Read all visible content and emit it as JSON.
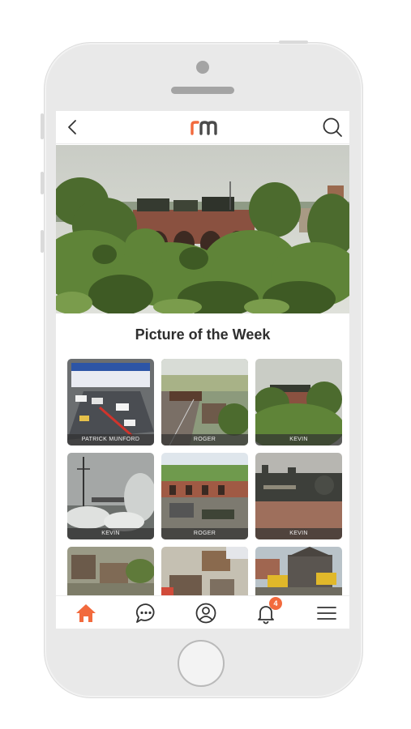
{
  "app": {
    "logo_text": "rm",
    "section_title": "Picture of the Week",
    "accent_color": "#f26a3d"
  },
  "topbar": {
    "back_icon": "chevron-left-icon",
    "search_icon": "search-icon"
  },
  "gallery": [
    {
      "caption": "PATRICK MUNFORD"
    },
    {
      "caption": "ROGER"
    },
    {
      "caption": "KEVIN"
    },
    {
      "caption": "KEVIN"
    },
    {
      "caption": "ROGER"
    },
    {
      "caption": "KEVIN"
    },
    {
      "caption": ""
    },
    {
      "caption": ""
    },
    {
      "caption": ""
    }
  ],
  "navbar": {
    "items": [
      "home-icon",
      "chat-icon",
      "profile-icon",
      "bell-icon",
      "menu-icon"
    ],
    "notification_count": "4"
  }
}
